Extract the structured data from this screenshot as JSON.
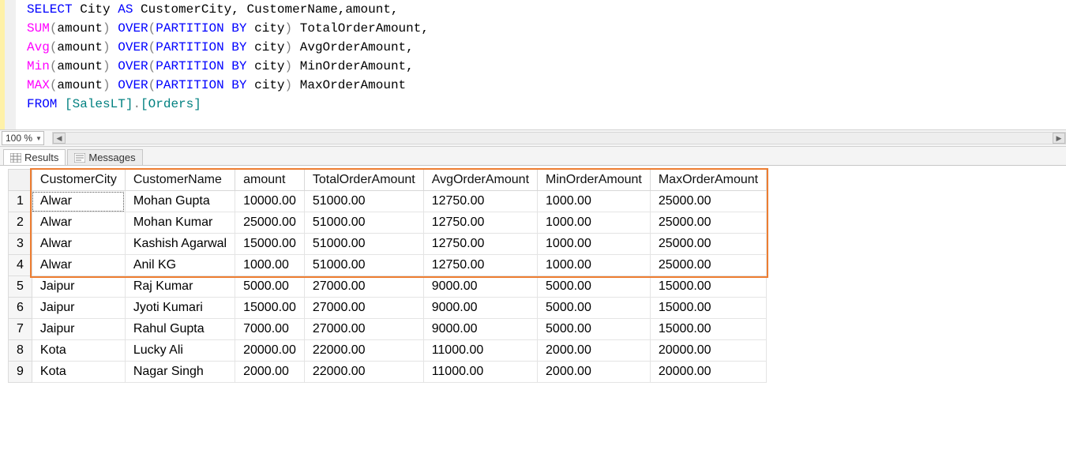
{
  "code_tokens": [
    [
      {
        "t": "SELECT",
        "c": "kw-blue"
      },
      {
        "t": " "
      },
      {
        "t": "City",
        "c": "ident"
      },
      {
        "t": " "
      },
      {
        "t": "AS",
        "c": "kw-blue"
      },
      {
        "t": " "
      },
      {
        "t": "CustomerCity",
        "c": "ident"
      },
      {
        "t": ","
      },
      {
        "t": " ",
        "c": "ident"
      },
      {
        "t": "CustomerName",
        "c": "ident"
      },
      {
        "t": ","
      },
      {
        "t": "amount",
        "c": "ident"
      },
      {
        "t": ","
      }
    ],
    [
      {
        "t": "SUM",
        "c": "kw-pink"
      },
      {
        "t": "(",
        "c": "kw-gray"
      },
      {
        "t": "amount",
        "c": "ident"
      },
      {
        "t": ")",
        "c": "kw-gray"
      },
      {
        "t": " "
      },
      {
        "t": "OVER",
        "c": "kw-blue"
      },
      {
        "t": "(",
        "c": "kw-gray"
      },
      {
        "t": "PARTITION",
        "c": "kw-blue"
      },
      {
        "t": " "
      },
      {
        "t": "BY",
        "c": "kw-blue"
      },
      {
        "t": " "
      },
      {
        "t": "city",
        "c": "ident"
      },
      {
        "t": ")",
        "c": "kw-gray"
      },
      {
        "t": " "
      },
      {
        "t": "TotalOrderAmount",
        "c": "ident"
      },
      {
        "t": ","
      }
    ],
    [
      {
        "t": "Avg",
        "c": "kw-pink"
      },
      {
        "t": "(",
        "c": "kw-gray"
      },
      {
        "t": "amount",
        "c": "ident"
      },
      {
        "t": ")",
        "c": "kw-gray"
      },
      {
        "t": " "
      },
      {
        "t": "OVER",
        "c": "kw-blue"
      },
      {
        "t": "(",
        "c": "kw-gray"
      },
      {
        "t": "PARTITION",
        "c": "kw-blue"
      },
      {
        "t": " "
      },
      {
        "t": "BY",
        "c": "kw-blue"
      },
      {
        "t": " "
      },
      {
        "t": "city",
        "c": "ident"
      },
      {
        "t": ")",
        "c": "kw-gray"
      },
      {
        "t": " "
      },
      {
        "t": "AvgOrderAmount",
        "c": "ident"
      },
      {
        "t": ","
      }
    ],
    [
      {
        "t": "Min",
        "c": "kw-pink"
      },
      {
        "t": "(",
        "c": "kw-gray"
      },
      {
        "t": "amount",
        "c": "ident"
      },
      {
        "t": ")",
        "c": "kw-gray"
      },
      {
        "t": " "
      },
      {
        "t": "OVER",
        "c": "kw-blue"
      },
      {
        "t": "(",
        "c": "kw-gray"
      },
      {
        "t": "PARTITION",
        "c": "kw-blue"
      },
      {
        "t": " "
      },
      {
        "t": "BY",
        "c": "kw-blue"
      },
      {
        "t": " "
      },
      {
        "t": "city",
        "c": "ident"
      },
      {
        "t": ")",
        "c": "kw-gray"
      },
      {
        "t": " "
      },
      {
        "t": "MinOrderAmount",
        "c": "ident"
      },
      {
        "t": ","
      }
    ],
    [
      {
        "t": "MAX",
        "c": "kw-pink"
      },
      {
        "t": "(",
        "c": "kw-gray"
      },
      {
        "t": "amount",
        "c": "ident"
      },
      {
        "t": ")",
        "c": "kw-gray"
      },
      {
        "t": " "
      },
      {
        "t": "OVER",
        "c": "kw-blue"
      },
      {
        "t": "(",
        "c": "kw-gray"
      },
      {
        "t": "PARTITION",
        "c": "kw-blue"
      },
      {
        "t": " "
      },
      {
        "t": "BY",
        "c": "kw-blue"
      },
      {
        "t": " "
      },
      {
        "t": "city",
        "c": "ident"
      },
      {
        "t": ")",
        "c": "kw-gray"
      },
      {
        "t": " "
      },
      {
        "t": "MaxOrderAmount",
        "c": "ident"
      }
    ],
    [
      {
        "t": "FROM",
        "c": "kw-blue"
      },
      {
        "t": " "
      },
      {
        "t": "[SalesLT]",
        "c": "kw-teal"
      },
      {
        "t": ".",
        "c": "kw-gray"
      },
      {
        "t": "[Orders]",
        "c": "kw-teal"
      }
    ]
  ],
  "zoom": {
    "value": "100 %"
  },
  "tabs": {
    "results": "Results",
    "messages": "Messages"
  },
  "table": {
    "columns": [
      "CustomerCity",
      "CustomerName",
      "amount",
      "TotalOrderAmount",
      "AvgOrderAmount",
      "MinOrderAmount",
      "MaxOrderAmount"
    ],
    "rows": [
      [
        "Alwar",
        "Mohan Gupta",
        "10000.00",
        "51000.00",
        "12750.00",
        "1000.00",
        "25000.00"
      ],
      [
        "Alwar",
        "Mohan Kumar",
        "25000.00",
        "51000.00",
        "12750.00",
        "1000.00",
        "25000.00"
      ],
      [
        "Alwar",
        "Kashish Agarwal",
        "15000.00",
        "51000.00",
        "12750.00",
        "1000.00",
        "25000.00"
      ],
      [
        "Alwar",
        "Anil KG",
        "1000.00",
        "51000.00",
        "12750.00",
        "1000.00",
        "25000.00"
      ],
      [
        "Jaipur",
        "Raj Kumar",
        "5000.00",
        "27000.00",
        "9000.00",
        "5000.00",
        "15000.00"
      ],
      [
        "Jaipur",
        "Jyoti Kumari",
        "15000.00",
        "27000.00",
        "9000.00",
        "5000.00",
        "15000.00"
      ],
      [
        "Jaipur",
        "Rahul Gupta",
        "7000.00",
        "27000.00",
        "9000.00",
        "5000.00",
        "15000.00"
      ],
      [
        "Kota",
        "Lucky Ali",
        "20000.00",
        "22000.00",
        "11000.00",
        "2000.00",
        "20000.00"
      ],
      [
        "Kota",
        "Nagar Singh",
        "2000.00",
        "22000.00",
        "11000.00",
        "2000.00",
        "20000.00"
      ]
    ],
    "highlighted_row_count": 4
  }
}
